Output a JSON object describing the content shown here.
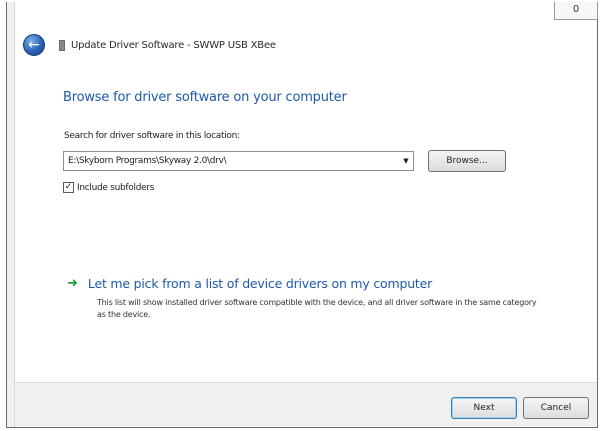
{
  "window": {
    "close_label": "0",
    "title": "Update Driver Software - SWWP USB XBee"
  },
  "main": {
    "heading": "Browse for driver software on your computer",
    "search_label": "Search for driver software in this location:",
    "path_value": "E:\\Skyborn Programs\\Skyway 2.0\\drv\\",
    "browse_label": "Browse...",
    "include_subfolders_label": "Include subfolders",
    "include_subfolders_checked": true,
    "pick_title": "Let me pick from a list of device drivers on my computer",
    "pick_description": "This list will show installed driver software compatible with the device, and all driver software in the same category as the device."
  },
  "footer": {
    "next_label": "Next",
    "cancel_label": "Cancel"
  },
  "icons": {
    "back": "back-arrow-icon",
    "driver": "driver-icon",
    "dropdown": "chevron-down-icon",
    "pick": "green-arrow-icon",
    "check": "checkmark-icon"
  },
  "colors": {
    "heading": "#1e5aa8",
    "link": "#1e5aa8",
    "pick_arrow": "#1b9a2c",
    "back_button": "#2b63b8"
  }
}
